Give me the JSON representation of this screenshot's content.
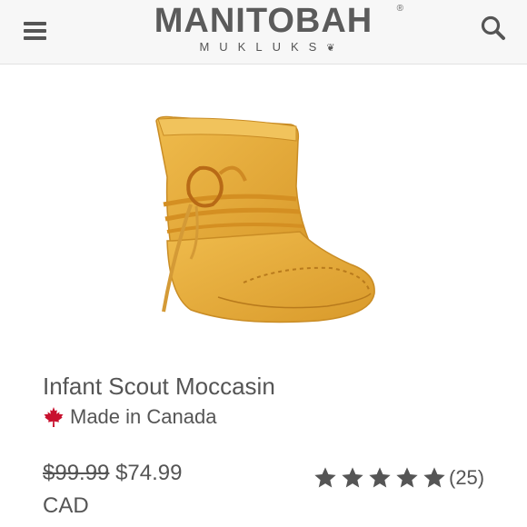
{
  "header": {
    "brand_name": "MANITOBAH",
    "brand_sub": "MUKLUKS",
    "registered_mark": "®"
  },
  "product": {
    "title": "Infant Scout Moccasin",
    "origin": "Made in Canada",
    "original_price": "$99.99",
    "sale_price": "$74.99",
    "currency": "CAD",
    "rating": 5,
    "review_count": "(25)"
  },
  "colors": {
    "accent_red": "#c8102e",
    "text_gray": "#555555",
    "moccasin_tan": "#e3a93a"
  },
  "icons": [
    "menu-icon",
    "search-icon",
    "maple-leaf-icon",
    "star-icon"
  ]
}
